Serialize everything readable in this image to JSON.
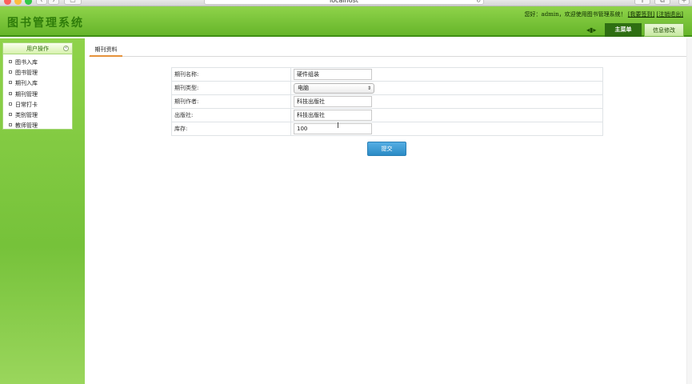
{
  "browser": {
    "url": "localhost"
  },
  "header": {
    "logo": "图书管理系统",
    "welcome_text": "您好：admin，欢迎使用图书管理系统！",
    "link_signin": "[我要签到]",
    "link_logout": "[注销退出]",
    "tabs": [
      {
        "label": "主菜单"
      },
      {
        "label": "信息修改"
      }
    ]
  },
  "sidebar": {
    "title": "用户操作",
    "items": [
      {
        "label": "图书入库"
      },
      {
        "label": "图书管理"
      },
      {
        "label": "期刊入库"
      },
      {
        "label": "期刊管理"
      },
      {
        "label": "日常打卡"
      },
      {
        "label": "类别管理"
      },
      {
        "label": "教师管理"
      }
    ]
  },
  "main": {
    "tab_label": "期刊资料",
    "form": {
      "fields": [
        {
          "label": "期刊名称:",
          "value": "硬件组装"
        },
        {
          "label": "期刊类型:",
          "value": "电脑"
        },
        {
          "label": "期刊作者:",
          "value": "科技出版社"
        },
        {
          "label": "出版社:",
          "value": "科技出版社"
        },
        {
          "label": "库存:",
          "value": "100"
        }
      ],
      "submit_label": "提交"
    }
  },
  "colors": {
    "header_green": "#7cc63d",
    "submit_blue": "#3a9ad4",
    "tab_dark": "#2e6e12"
  }
}
